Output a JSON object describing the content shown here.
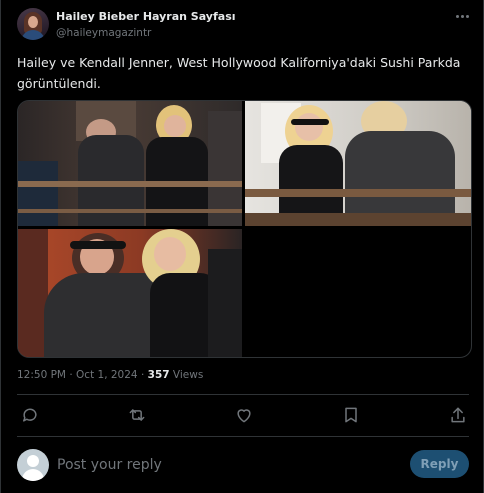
{
  "author": {
    "display_name": "Hailey Bieber Hayran Sayfası",
    "handle": "@haileymagazintr",
    "more_icon": "more-horizontal-icon"
  },
  "tweet": {
    "text_line1": "Hailey ve Kendall Jenner, West Hollywood Kaliforniya'daki Sushi Parkda",
    "text_line2": "görüntülendi."
  },
  "media": {
    "photo_count": 3
  },
  "meta": {
    "time": "12:50 PM",
    "separator": "·",
    "date": "Oct 1, 2024",
    "views_count": "357",
    "views_label": "Views"
  },
  "actions": [
    {
      "name": "reply",
      "icon": "reply-icon"
    },
    {
      "name": "retweet",
      "icon": "retweet-icon"
    },
    {
      "name": "like",
      "icon": "heart-icon"
    },
    {
      "name": "bookmark",
      "icon": "bookmark-icon"
    },
    {
      "name": "share",
      "icon": "share-icon"
    }
  ],
  "reply_bar": {
    "placeholder": "Post your reply",
    "button_label": "Reply"
  },
  "colors": {
    "background": "#000000",
    "text_primary": "#e7e9ea",
    "text_secondary": "#71767b",
    "border": "#2f3336",
    "reply_button_bg": "#1d4f72"
  }
}
